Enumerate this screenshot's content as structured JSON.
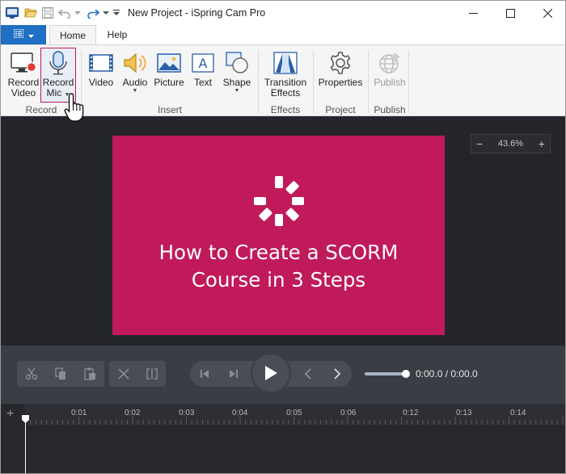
{
  "window": {
    "title": "New Project - iSpring Cam Pro"
  },
  "quick_access": {
    "app_icon": "app-icon",
    "open_icon": "folder-open-icon",
    "save_icon": "save-icon",
    "undo_icon": "undo-icon",
    "redo_icon": "redo-icon",
    "customize_icon": "customize-caret-icon"
  },
  "tabs": {
    "file_icon": "menu-icon",
    "home": "Home",
    "help": "Help"
  },
  "ribbon": {
    "record": {
      "video": [
        "Record",
        "Video"
      ],
      "mic": [
        "Record",
        "Mic"
      ],
      "group": "Record"
    },
    "insert": {
      "video": "Video",
      "audio": "Audio",
      "picture": "Picture",
      "text": "Text",
      "shape": "Shape",
      "group": "Insert"
    },
    "effects": {
      "transition": [
        "Transition",
        "Effects"
      ],
      "group": "Effects"
    },
    "project": {
      "properties": "Properties",
      "group": "Project"
    },
    "publish": {
      "publish": "Publish",
      "group": "Publish"
    }
  },
  "canvas": {
    "zoom": "43.6%",
    "slide_title_line1": "How to Create a SCORM",
    "slide_title_line2": "Course in 3 Steps",
    "slide_color": "#c01a5b"
  },
  "playback": {
    "time": "0:00.0 / 0:00.0"
  },
  "timeline": {
    "ticks": [
      "0:01",
      "0:02",
      "0:03",
      "0:04",
      "0:05",
      "0:06",
      "0:12",
      "0:13",
      "0:14"
    ]
  },
  "colors": {
    "accent": "#1f6fc5",
    "selection_border": "#c2185b",
    "canvas_bg": "#24252a",
    "controls_bg": "#3b3d45"
  }
}
